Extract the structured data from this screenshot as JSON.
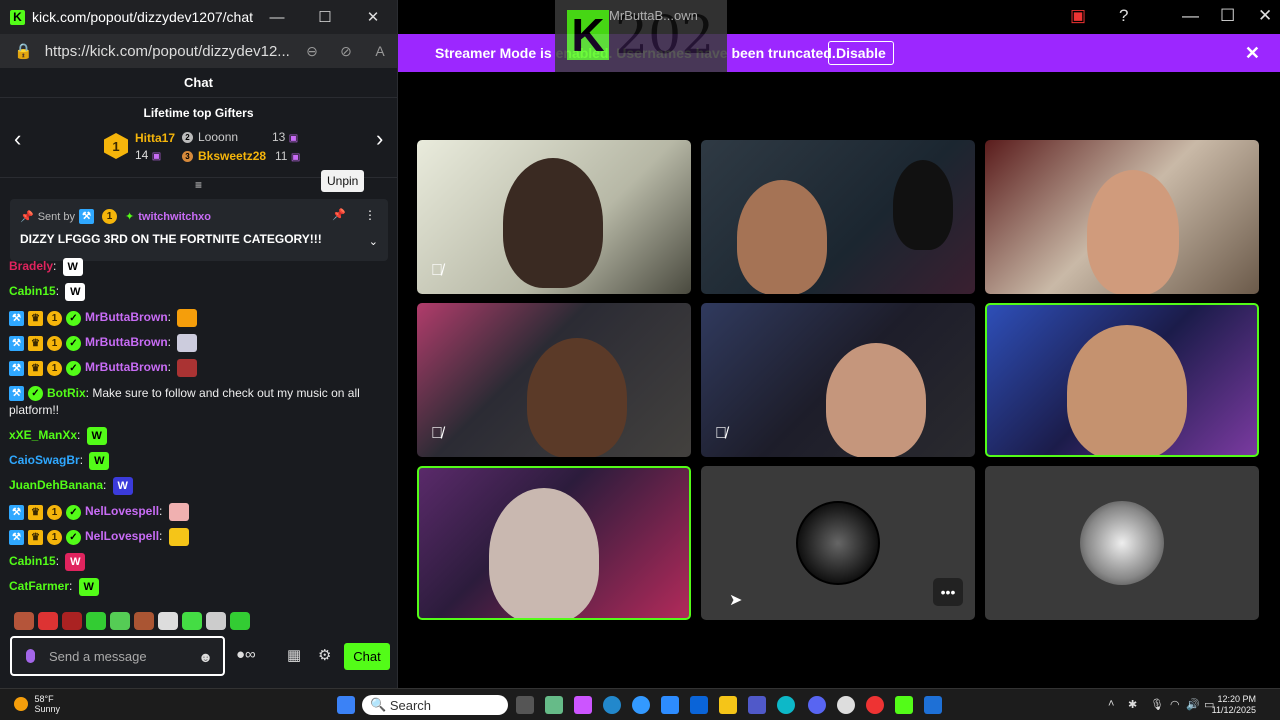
{
  "browser": {
    "title": "kick.com/popout/dizzydev1207/chat -...",
    "url": "https://kick.com/popout/dizzydev12..."
  },
  "chat": {
    "header": "Chat",
    "gifters_title": "Lifetime top Gifters",
    "gifters": [
      {
        "rank": "1",
        "name": "Hitta17",
        "count": "14"
      },
      {
        "rank": "2",
        "name": "Looonn",
        "count": "13"
      },
      {
        "rank": "3",
        "name": "Bksweetz28",
        "count": "11"
      }
    ],
    "tooltip": "Unpin",
    "pinned": {
      "sent_by": "Sent by",
      "user": "twitchwitchxo",
      "message": "DIZZY LFGGG 3RD ON THE FORTNITE CATEGORY!!!"
    },
    "messages": [
      {
        "user": "Bradely",
        "color": "#e0245e",
        "text": ""
      },
      {
        "user": "Cabin15",
        "color": "#53fc18",
        "text": ""
      },
      {
        "user": "MrButtaBrown",
        "color": "#c86cf5",
        "text": ""
      },
      {
        "user": "MrButtaBrown",
        "color": "#c86cf5",
        "text": ""
      },
      {
        "user": "MrButtaBrown",
        "color": "#c86cf5",
        "text": ""
      },
      {
        "user": "BotRix",
        "color": "#53fc18",
        "text": "Make sure to follow and check out my music on all",
        "text2": "platform!!"
      },
      {
        "user": "xXE_ManXx",
        "color": "#53fc18",
        "text": ""
      },
      {
        "user": "CaioSwagBr",
        "color": "#2fa8ff",
        "text": ""
      },
      {
        "user": "JuanDehBanana",
        "color": "#53fc18",
        "text": ""
      },
      {
        "user": "NelLovespell",
        "color": "#c86cf5",
        "text": ""
      },
      {
        "user": "NelLovespell",
        "color": "#c86cf5",
        "text": ""
      },
      {
        "user": "Cabin15",
        "color": "#53fc18",
        "text": ""
      },
      {
        "user": "CatFarmer",
        "color": "#53fc18",
        "text": ""
      }
    ],
    "input_placeholder": "Send a message",
    "chat_button": "Chat"
  },
  "overlay": {
    "name": "MrButtaB...own",
    "number": "202"
  },
  "streamer_mode": {
    "text": "Streamer Mode is enabled. Usernames have been truncated.",
    "disable": "Disable"
  },
  "taskbar": {
    "temp": "58°F",
    "weather": "Sunny",
    "search": "Search",
    "time": "12:20 PM",
    "date": "11/12/2025"
  },
  "colors": {
    "kick_green": "#53fc18",
    "streamer_purple": "#9c27ff"
  }
}
